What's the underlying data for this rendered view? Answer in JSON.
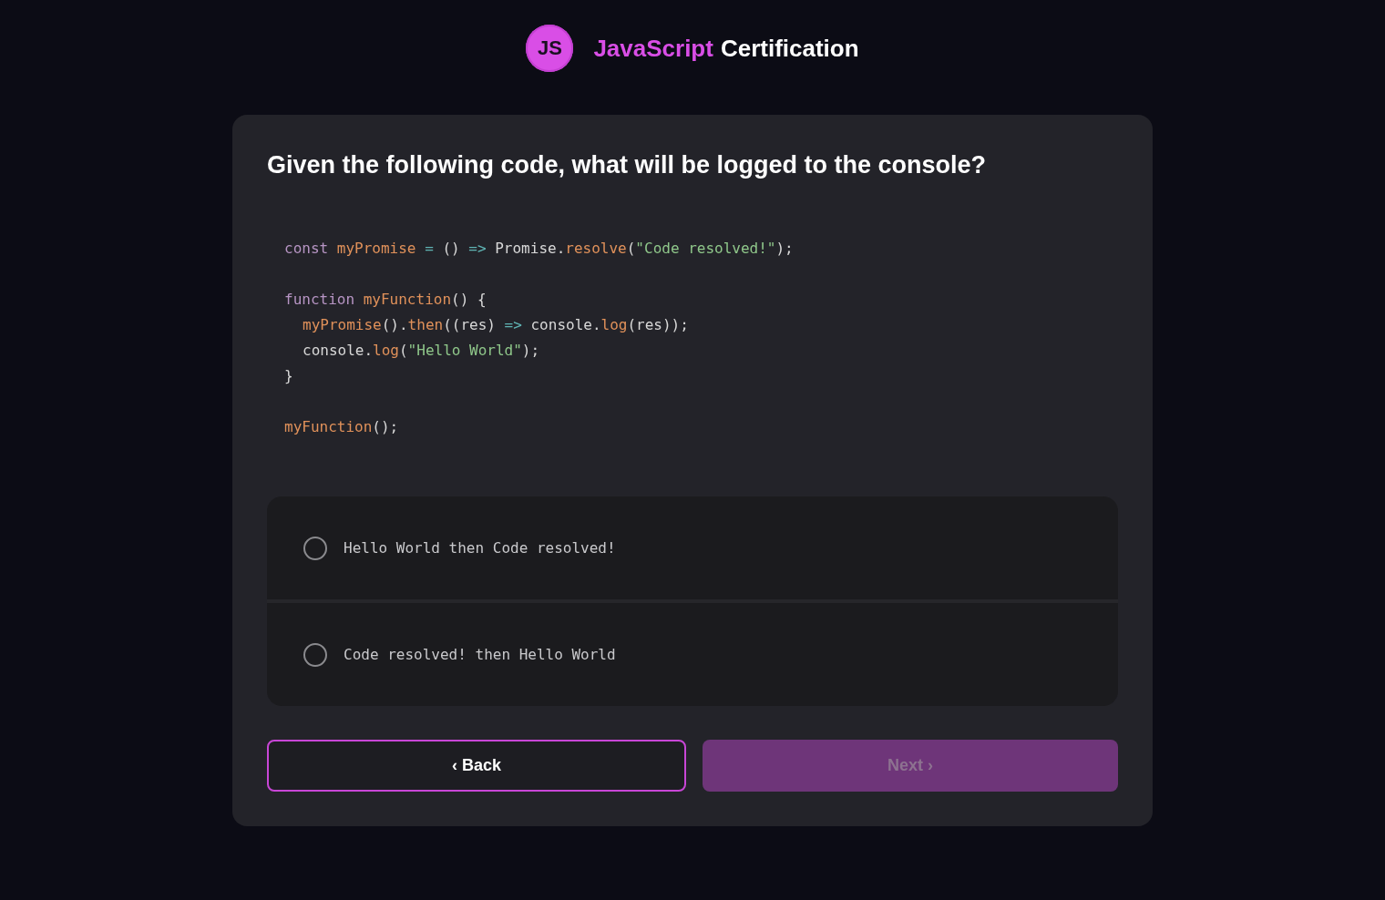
{
  "header": {
    "logo": "JS",
    "title_accent": "JavaScript",
    "title_rest": "Certification"
  },
  "question": "Given the following code, what will be logged to the console?",
  "code_blocks": [
    [
      {
        "tokens": [
          {
            "kind": "keyword",
            "text": "const "
          },
          {
            "kind": "name",
            "text": "myPromise"
          },
          {
            "kind": "op",
            "text": " = "
          },
          {
            "kind": "plain",
            "text": "() "
          },
          {
            "kind": "op",
            "text": "=> "
          },
          {
            "kind": "plain",
            "text": "Promise."
          },
          {
            "kind": "name",
            "text": "resolve"
          },
          {
            "kind": "plain",
            "text": "("
          },
          {
            "kind": "string",
            "text": "\"Code resolved!\""
          },
          {
            "kind": "plain",
            "text": ");"
          }
        ]
      }
    ],
    [
      {
        "tokens": [
          {
            "kind": "keyword",
            "text": "function "
          },
          {
            "kind": "name",
            "text": "myFunction"
          },
          {
            "kind": "plain",
            "text": "() {"
          }
        ],
        "children": [
          {
            "tokens": [
              {
                "kind": "name",
                "text": "myPromise"
              },
              {
                "kind": "plain",
                "text": "()."
              },
              {
                "kind": "name",
                "text": "then"
              },
              {
                "kind": "plain",
                "text": "((res) "
              },
              {
                "kind": "op",
                "text": "=> "
              },
              {
                "kind": "plain",
                "text": "console."
              },
              {
                "kind": "name",
                "text": "log"
              },
              {
                "kind": "plain",
                "text": "(res));"
              }
            ]
          },
          {
            "tokens": [
              {
                "kind": "plain",
                "text": "console."
              },
              {
                "kind": "name",
                "text": "log"
              },
              {
                "kind": "plain",
                "text": "("
              },
              {
                "kind": "string",
                "text": "\"Hello World\""
              },
              {
                "kind": "plain",
                "text": ");"
              }
            ]
          }
        ]
      },
      {
        "tokens": [
          {
            "kind": "plain",
            "text": "}"
          }
        ]
      }
    ],
    [
      {
        "tokens": [
          {
            "kind": "name",
            "text": "myFunction"
          },
          {
            "kind": "plain",
            "text": "();"
          }
        ]
      }
    ]
  ],
  "options": [
    {
      "label": "Hello World then Code resolved!",
      "selected": false
    },
    {
      "label": "Code resolved! then Hello World",
      "selected": false
    }
  ],
  "buttons": {
    "back": {
      "label": "‹ Back",
      "disabled": false
    },
    "next": {
      "label": "Next ›",
      "disabled": true
    }
  }
}
